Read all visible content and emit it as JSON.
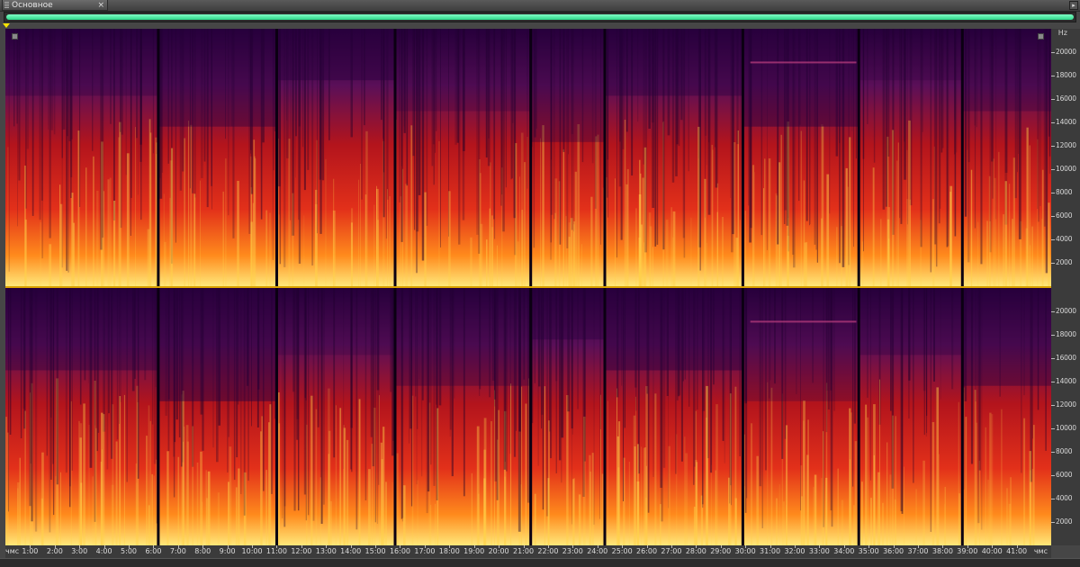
{
  "tab": {
    "title": "Основное"
  },
  "spectrogram": {
    "freq_unit": "Hz",
    "freq_labels": [
      "20000",
      "18000",
      "16000",
      "14000",
      "12000",
      "10000",
      "8000",
      "6000",
      "4000",
      "2000"
    ],
    "time_unit_left": "чмс",
    "time_unit_right": "чмс",
    "time_labels": [
      "1:00",
      "2:00",
      "3:00",
      "4:00",
      "5:00",
      "6:00",
      "7:00",
      "8:00",
      "9:00",
      "10:00",
      "11:00",
      "12:00",
      "13:00",
      "14:00",
      "15:00",
      "16:00",
      "17:00",
      "18:00",
      "19:00",
      "20:00",
      "21:00",
      "22:00",
      "23:00",
      "24:00",
      "25:00",
      "26:00",
      "27:00",
      "28:00",
      "29:00",
      "30:00",
      "31:00",
      "32:00",
      "33:00",
      "34:00",
      "35:00",
      "36:00",
      "37:00",
      "38:00",
      "39:00",
      "40:00",
      "41:00"
    ],
    "track_boundaries_min": [
      6.2,
      11.0,
      15.8,
      21.3,
      24.3,
      29.9,
      34.6,
      38.8
    ],
    "total_duration_min": 42.4,
    "freq_max_hz": 22000,
    "colors": {
      "low": "#1a0030",
      "mid": "#c01810",
      "high": "#ffe060",
      "accent": "#2fd68a"
    }
  }
}
